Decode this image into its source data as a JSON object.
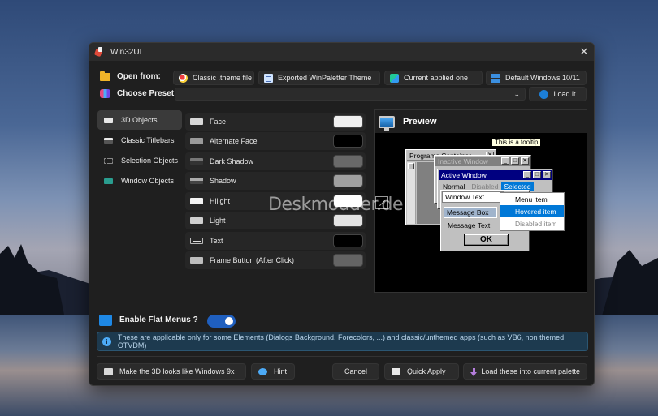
{
  "watermark": "Deskmodder.de",
  "window": {
    "title": "Win32UI",
    "close_glyph": "✕"
  },
  "open_from": {
    "label": "Open from:",
    "buttons": [
      {
        "label": "Classic .theme file",
        "icon": "theme-file-icon"
      },
      {
        "label": "Exported WinPaletter Theme",
        "icon": "document-icon"
      },
      {
        "label": "Current applied one",
        "icon": "applied-theme-icon"
      },
      {
        "label": "Default Windows 10/11",
        "icon": "windows-logo-icon"
      }
    ]
  },
  "preset": {
    "label": "Choose Preset:",
    "value": "",
    "chevron": "⌄",
    "load_label": "Load it"
  },
  "sidebar": {
    "items": [
      {
        "label": "3D Objects",
        "active": true
      },
      {
        "label": "Classic Titlebars",
        "active": false
      },
      {
        "label": "Selection Objects",
        "active": false
      },
      {
        "label": "Window Objects",
        "active": false
      }
    ]
  },
  "properties": [
    {
      "label": "Face",
      "color": "#f0f0f0"
    },
    {
      "label": "Alternate Face",
      "color": "#000000"
    },
    {
      "label": "Dark Shadow",
      "color": "#696969"
    },
    {
      "label": "Shadow",
      "color": "#a0a0a0"
    },
    {
      "label": "Hilight",
      "color": "#ffffff"
    },
    {
      "label": "Light",
      "color": "#e3e3e3"
    },
    {
      "label": "Text",
      "color": "#000000"
    },
    {
      "label": "Frame Button (After Click)",
      "color": "#646464"
    }
  ],
  "preview": {
    "title": "Preview",
    "programs_container": "Programs Container",
    "tooltip": "This is a tooltip",
    "inactive_window": "Inactive Window",
    "active_window": "Active Window",
    "tabs": {
      "normal": "Normal",
      "disabled": "Disabled",
      "selected": "Selected"
    },
    "window_text": "Window Text",
    "menu": {
      "item": "Menu item",
      "hovered": "Hovered item",
      "disabled": "Disabled item"
    },
    "message_box": "Message Box",
    "message_text": "Message Text",
    "ok": "OK",
    "btn_min": "_",
    "btn_max": "□",
    "btn_close": "✕",
    "colors": {
      "active_title": "#000080",
      "inactive_title": "#808080",
      "highlight": "#0078d7",
      "window_bg": "#ffffff",
      "face": "#c0c0c0"
    }
  },
  "flat_menus": {
    "label": "Enable Flat Menus ?",
    "enabled": true
  },
  "info": {
    "glyph": "i",
    "text": "These are applicable only for some Elements (Dialogs Background, Forecolors, ...) and classic/unthemed apps (such as VB6, non themed OTVDM)"
  },
  "footer": {
    "make_3d": "Make the 3D looks like Windows 9x",
    "hint": "Hint",
    "cancel": "Cancel",
    "quick_apply": "Quick Apply",
    "load_into": "Load these into current palette"
  }
}
